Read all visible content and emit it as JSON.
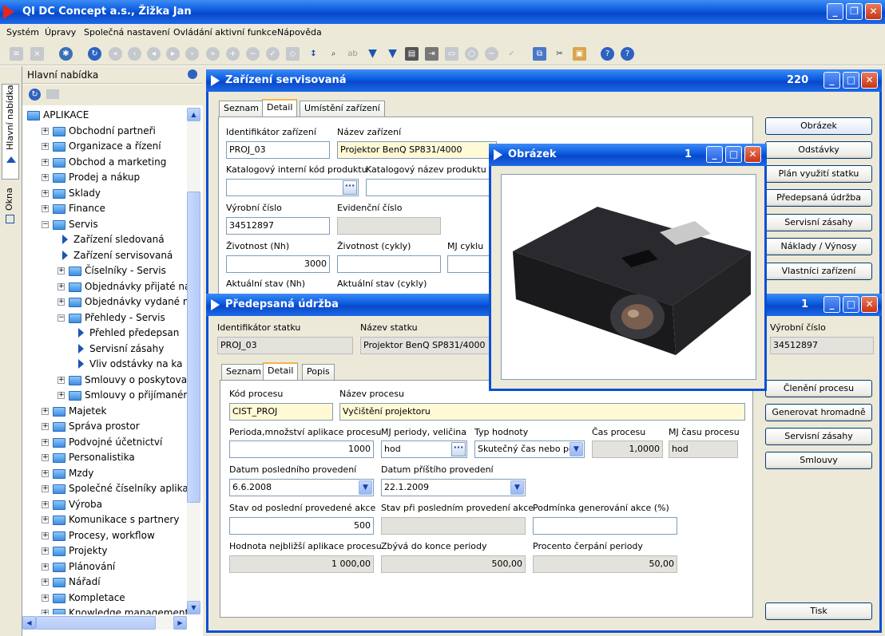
{
  "app": {
    "title": "QI  DC Concept a.s.,  Žižka Jan"
  },
  "menu": [
    "Systém",
    "Úpravy",
    "Společná nastavení",
    "Ovládání aktivní funkce",
    "Nápověda"
  ],
  "sidebar": {
    "title": "Hlavní nabídka",
    "vtabs": [
      "Hlavní nabídka",
      "Okna"
    ],
    "tree": [
      {
        "label": "APLIKACE",
        "type": "root"
      },
      {
        "label": "Obchodní partneři",
        "type": "folder"
      },
      {
        "label": "Organizace a řízení",
        "type": "folder"
      },
      {
        "label": "Obchod a marketing",
        "type": "folder"
      },
      {
        "label": "Prodej a nákup",
        "type": "folder"
      },
      {
        "label": "Sklady",
        "type": "folder"
      },
      {
        "label": "Finance",
        "type": "folder"
      },
      {
        "label": "Servis",
        "type": "folder-open"
      },
      {
        "label": "Zařízení sledovaná",
        "type": "item"
      },
      {
        "label": "Zařízení servisovaná",
        "type": "item"
      },
      {
        "label": "Číselníky - Servis",
        "type": "folder"
      },
      {
        "label": "Objednávky přijaté na",
        "type": "folder"
      },
      {
        "label": "Objednávky vydané na",
        "type": "folder"
      },
      {
        "label": "Přehledy - Servis",
        "type": "folder-open"
      },
      {
        "label": "Přehled předepsan",
        "type": "item"
      },
      {
        "label": "Servisní zásahy",
        "type": "item"
      },
      {
        "label": "Vliv odstávky na ka",
        "type": "item"
      },
      {
        "label": "Smlouvy o poskytovan",
        "type": "folder"
      },
      {
        "label": "Smlouvy o přijímaném",
        "type": "folder"
      },
      {
        "label": "Majetek",
        "type": "folder"
      },
      {
        "label": "Správa prostor",
        "type": "folder"
      },
      {
        "label": "Podvojné účetnictví",
        "type": "folder"
      },
      {
        "label": "Personalistika",
        "type": "folder"
      },
      {
        "label": "Mzdy",
        "type": "folder"
      },
      {
        "label": "Společné číselníky aplikac",
        "type": "folder"
      },
      {
        "label": "Výroba",
        "type": "folder"
      },
      {
        "label": "Komunikace s partnery",
        "type": "folder"
      },
      {
        "label": "Procesy, workflow",
        "type": "folder"
      },
      {
        "label": "Projekty",
        "type": "folder"
      },
      {
        "label": "Plánování",
        "type": "folder"
      },
      {
        "label": "Nářadí",
        "type": "folder"
      },
      {
        "label": "Kompletace",
        "type": "folder"
      },
      {
        "label": "Knowledge management",
        "type": "folder"
      }
    ]
  },
  "win_zarizeni": {
    "title": "Zařízení servisovaná",
    "count": "220",
    "tabs": [
      "Seznam",
      "Detail",
      "Umístění zařízení"
    ],
    "fields": {
      "id_label": "Identifikátor zařízení",
      "id_value": "PROJ_03",
      "name_label": "Název zařízení",
      "name_value": "Projektor BenQ SP831/4000",
      "katkod_label": "Katalogový interní kód produktu",
      "katname_label": "Katalogový název produktu",
      "serial_label": "Výrobní číslo",
      "serial_value": "34512897",
      "evid_label": "Evidenční číslo",
      "life_label": "Životnost (Nh)",
      "life_value": "3000",
      "cycles_label": "Životnost (cykly)",
      "mj_label": "MJ cyklu",
      "curr_label": "Aktuální stav (Nh)",
      "currc_label": "Aktuální stav (cykly)"
    },
    "buttons": [
      "Obrázek",
      "Odstávky",
      "Plán využití statku",
      "Předepsaná údržba",
      "Servisní zásahy",
      "Náklady / Výnosy",
      "Vlastníci zařízení"
    ]
  },
  "win_obrazek": {
    "title": "Obrázek",
    "count": "1",
    "image_alt": "Projektor BenQ"
  },
  "win_udrzba": {
    "title": "Předepsaná údržba",
    "count": "1",
    "header": {
      "stat_id_label": "Identifikátor statku",
      "stat_id_value": "PROJ_03",
      "stat_name_label": "Název statku",
      "stat_name_value": "Projektor BenQ SP831/4000",
      "serial_label": "Výrobní číslo",
      "serial_value": "34512897"
    },
    "tabs": [
      "Seznam",
      "Detail",
      "Popis"
    ],
    "fields": {
      "code_label": "Kód procesu",
      "code_value": "CIST_PROJ",
      "pname_label": "Název procesu",
      "pname_value": "Vyčištění projektoru",
      "period_label": "Perioda,množství aplikace procesu",
      "period_value": "1000",
      "mjp_label": "MJ periody, veličina",
      "mjp_value": "hod",
      "type_label": "Typ hodnoty",
      "type_value": "Skutečný čas nebo po",
      "time_label": "Čas procesu",
      "time_value": "1,0000",
      "mjt_label": "MJ času procesu",
      "mjt_value": "hod",
      "last_label": "Datum posledního provedení",
      "last_value": "6.6.2008",
      "next_label": "Datum příštího provedení",
      "next_value": "22.1.2009",
      "statelast_label": "Stav od poslední provedené akce",
      "statelast_value": "500",
      "stateat_label": "Stav při posledním provedení akce",
      "cond_label": "Podmínka generování akce (%)",
      "nextval_label": "Hodnota nejbližší aplikace procesu",
      "nextval_value": "1 000,00",
      "remain_label": "Zbývá do konce periody",
      "remain_value": "500,00",
      "pct_label": "Procento čerpání periody",
      "pct_value": "50,00"
    },
    "buttons": [
      "Členění procesu",
      "Generovat hromadně",
      "Servisní zásahy",
      "Smlouvy"
    ],
    "print": "Tisk"
  }
}
